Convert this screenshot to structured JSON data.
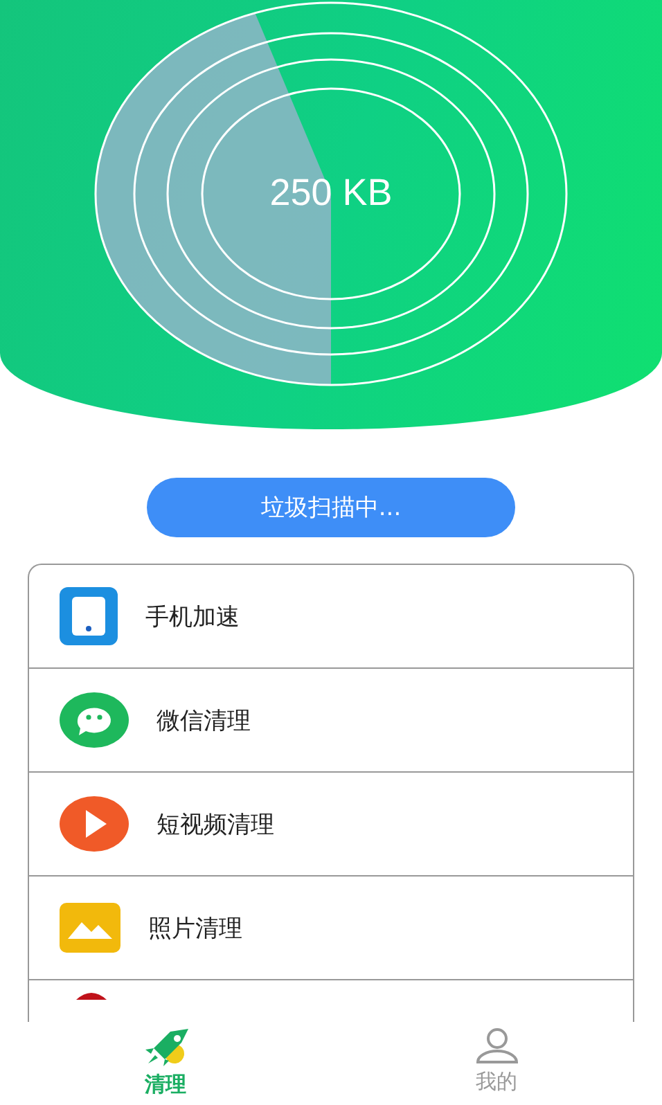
{
  "scan": {
    "size": "250 KB"
  },
  "status_button": "垃圾扫描中...",
  "items": [
    {
      "kind": "phone",
      "label": "手机加速"
    },
    {
      "kind": "chat",
      "label": "微信清理"
    },
    {
      "kind": "video",
      "label": "短视频清理"
    },
    {
      "kind": "photo",
      "label": "照片清理"
    },
    {
      "kind": "partial"
    }
  ],
  "tabs": [
    {
      "label": "清理",
      "kind": "rocket",
      "selected": true
    },
    {
      "label": "我的",
      "kind": "user",
      "selected": false
    }
  ]
}
